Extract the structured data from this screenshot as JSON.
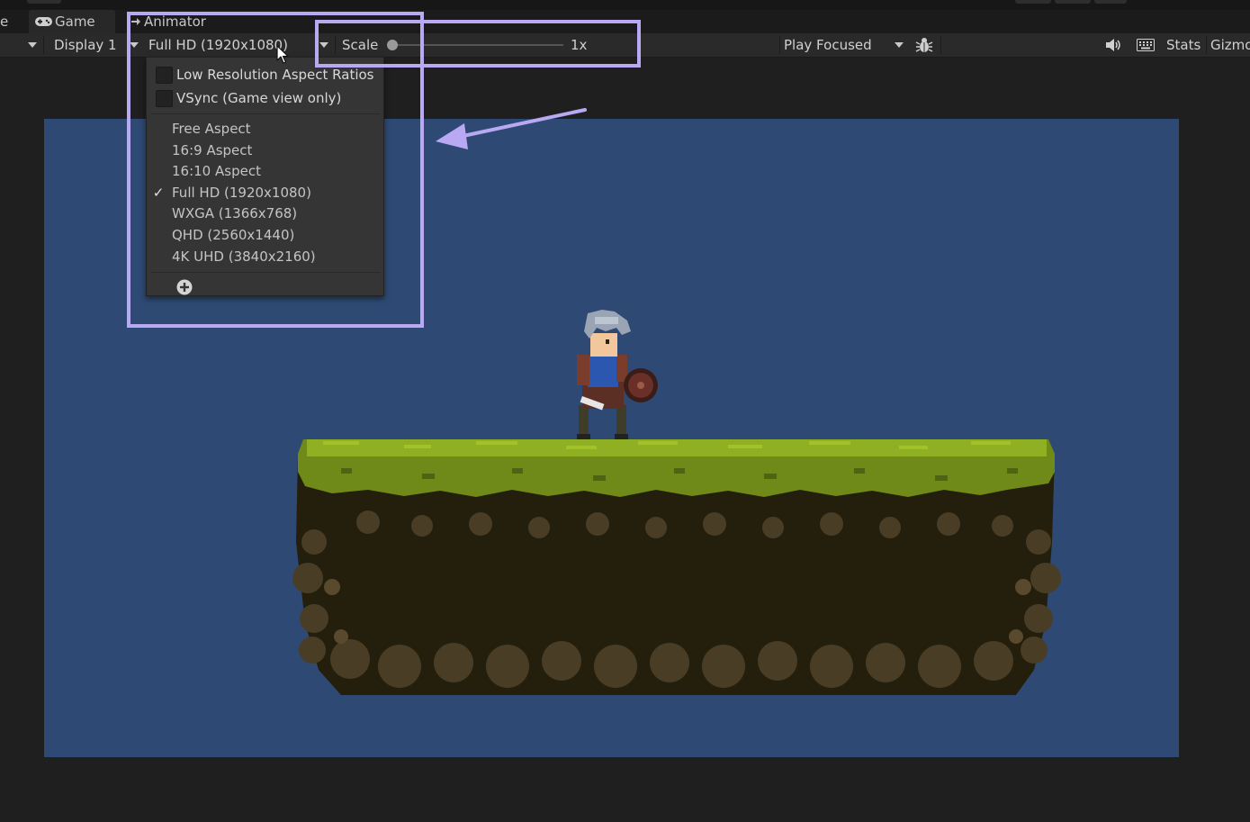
{
  "tabs": {
    "partial_tab_label": "e",
    "game_label": "Game",
    "animator_label": "Animator"
  },
  "toolbar": {
    "display_label": "Display 1",
    "resolution_label": "Full HD (1920x1080)",
    "scale_label": "Scale",
    "scale_value": "1x",
    "scale_level": 0.0,
    "play_mode_label": "Play Focused",
    "stats_label": "Stats",
    "gizmos_label": "Gizmo"
  },
  "resolution_menu": {
    "low_res_label": "Low Resolution Aspect Ratios",
    "low_res_checked": false,
    "vsync_label": "VSync (Game view only)",
    "vsync_checked": false,
    "items": [
      {
        "label": "Free Aspect",
        "selected": false
      },
      {
        "label": "16:9 Aspect",
        "selected": false
      },
      {
        "label": "16:10 Aspect",
        "selected": false
      },
      {
        "label": "Full HD (1920x1080)",
        "selected": true
      },
      {
        "label": "WXGA (1366x768)",
        "selected": false
      },
      {
        "label": "QHD (2560x1440)",
        "selected": false
      },
      {
        "label": "4K UHD (3840x2160)",
        "selected": false
      }
    ],
    "checkmark": "✓"
  },
  "colors": {
    "highlight": "#b8a9f2",
    "game_background": "#2e4a74",
    "grass": "#7c9a1c",
    "dirt": "#2a2a12",
    "rock": "#4a3d25"
  },
  "icons": {
    "game_tab": "gamepad-icon",
    "animator_tab": "animator-icon",
    "play_mode": "bug-icon",
    "audio": "speaker-icon",
    "keyboard": "keyboard-icon",
    "add": "plus-circle-icon"
  }
}
